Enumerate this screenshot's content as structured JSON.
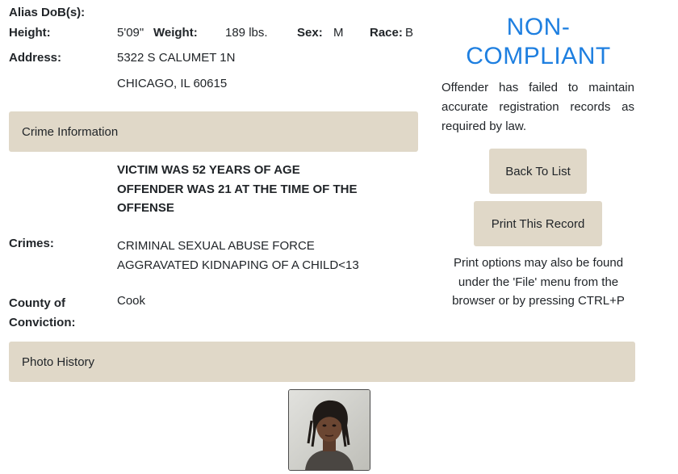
{
  "personal": {
    "alias_dob_label": "Alias DoB(s):",
    "height_label": "Height:",
    "height_value": "5'09\"",
    "weight_label": "Weight:",
    "weight_value": "189 lbs.",
    "sex_label": "Sex:",
    "sex_value": "M",
    "race_label": "Race:",
    "race_value": "B",
    "address_label": "Address:",
    "address_line1": "5322 S CALUMET 1N",
    "address_line2": "CHICAGO, IL 60615"
  },
  "crime_section": {
    "header": "Crime Information",
    "notes": [
      "VICTIM WAS 52 YEARS OF AGE",
      "OFFENDER WAS 21 AT THE TIME OF THE",
      "OFFENSE"
    ],
    "crimes_label": "Crimes:",
    "crimes": [
      "CRIMINAL SEXUAL ABUSE FORCE",
      "AGGRAVATED KIDNAPING OF A CHILD<13"
    ],
    "county_label_line1": "County of",
    "county_label_line2": "Conviction:",
    "county_value": "Cook"
  },
  "status_panel": {
    "status_line1": "NON-",
    "status_line2": "COMPLIANT",
    "status_color": "#1e7fe0",
    "notice": "Offender has failed to maintain accurate registration records as required by law.",
    "back_button": "Back To List",
    "print_button": "Print This Record",
    "print_hint": "Print options may also be found under the 'File' menu from the browser or by pressing CTRL+P"
  },
  "photo_section": {
    "header": "Photo History"
  },
  "colors": {
    "band_bg": "#e0d8c8",
    "accent": "#1e7fe0"
  }
}
